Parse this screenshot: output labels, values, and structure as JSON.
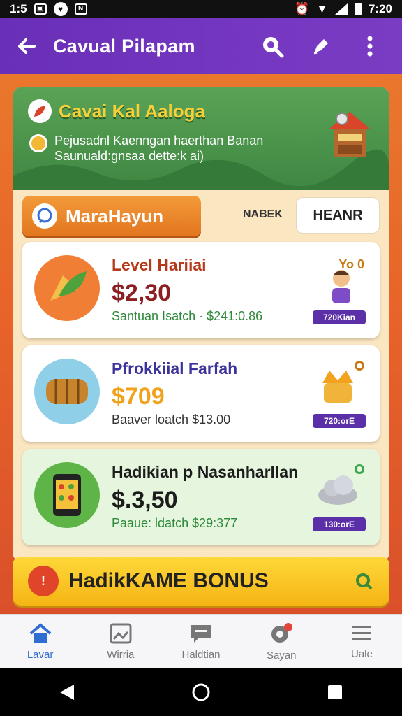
{
  "status_bar": {
    "time_left": "1:5",
    "time_right": "7:20"
  },
  "app_bar": {
    "title": "Cavual Pilapam"
  },
  "banner": {
    "title": "Cavai Kal Aaloga",
    "subtitle_line1": "Pejusadnl Kaenngan haerthan Banan",
    "subtitle_line2": "Saunuald:gnsaa dette:k ai)"
  },
  "tabs": {
    "active": "MaraHayun",
    "plain": "NABEK",
    "button": "HEANR"
  },
  "cards": [
    {
      "title": "Level Hariiai",
      "price": "$2,30",
      "sub": "Santuan Isatch · $241:0.86",
      "corner": "Yo 0",
      "badge": "720Kian",
      "title_color": "#b63a1a",
      "price_color": "#8b1f22",
      "sub_color": "#2e8a3a"
    },
    {
      "title": "Pfrokkiial Farfah",
      "price": "$709",
      "sub": "Baaver loatch  $13.00",
      "corner": "",
      "badge": "720:orE",
      "title_color": "#3b3399",
      "price_color": "#f0a21c",
      "sub_color": "#333333"
    },
    {
      "title": "Hadikian p Nasanharllan",
      "price": "$.3,50",
      "sub": "Paaue: ldatch  $29:377",
      "corner": "",
      "badge": "130:orE",
      "title_color": "#1c1c1c",
      "price_color": "#1c1c1c",
      "sub_color": "#2e8a3a"
    }
  ],
  "bonus": {
    "label": "HadikKAME BONUS"
  },
  "bottom_nav": [
    {
      "label": "Lavar",
      "icon": "home-icon"
    },
    {
      "label": "Wirria",
      "icon": "image-icon"
    },
    {
      "label": "Haldtian",
      "icon": "chat-bubble-icon"
    },
    {
      "label": "Sayan",
      "icon": "settings-icon"
    },
    {
      "label": "Uale",
      "icon": "menu-icon"
    }
  ],
  "colors": {
    "app_bar": "#6a2fb7",
    "accent": "#e8632a",
    "nav_active": "#2f6dd3"
  }
}
